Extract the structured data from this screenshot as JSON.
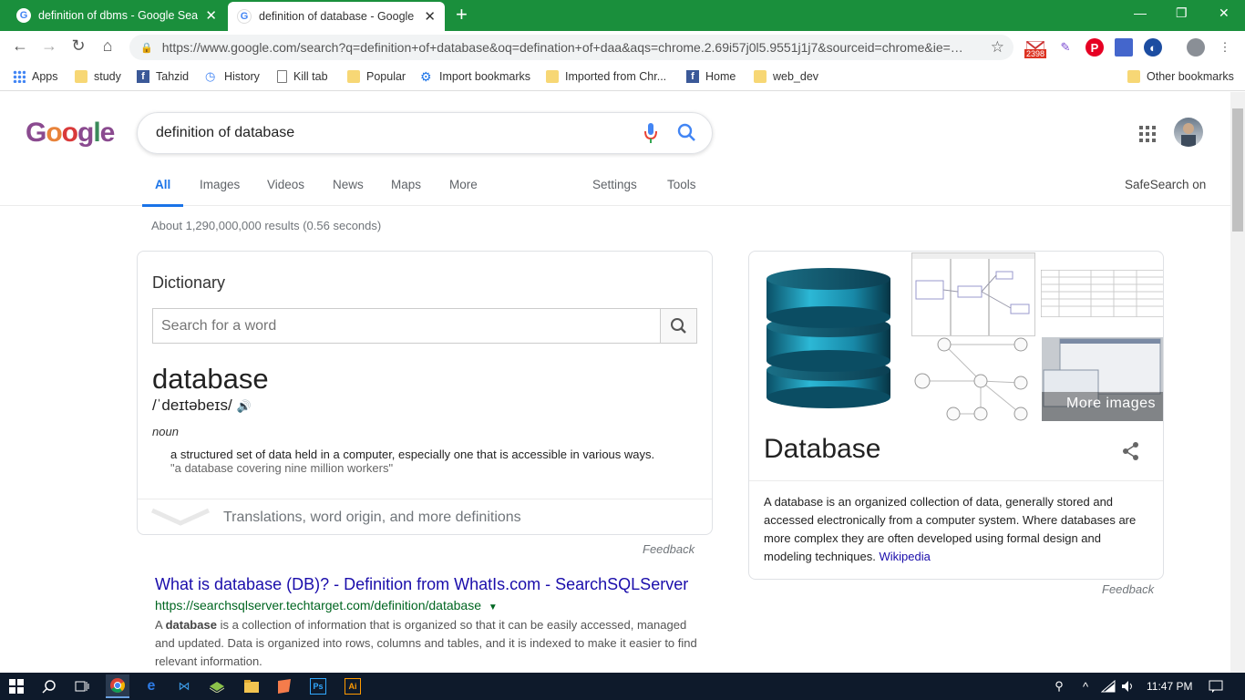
{
  "tabs": [
    {
      "title": "definition of dbms - Google Sear",
      "close": "✕"
    },
    {
      "title": "definition of database - Google S",
      "close": "✕"
    }
  ],
  "new_tab": "+",
  "window_controls": {
    "minimize": "—",
    "maximize": "❐",
    "close": "✕"
  },
  "address_bar": {
    "url": "https://www.google.com/search?q=definition+of+database&oq=defination+of+daa&aqs=chrome.2.69i57j0l5.9551j1j7&sourceid=chrome&ie=…"
  },
  "extensions": {
    "gmail_badge": "2398"
  },
  "bookmarks": [
    "Apps",
    "study",
    "Tahzid",
    "History",
    "Kill tab",
    "Popular",
    "Import bookmarks",
    "Imported from Chr...",
    "Home",
    "web_dev"
  ],
  "other_bookmarks": "Other bookmarks",
  "logo": "Google",
  "search": {
    "query": "definition of database"
  },
  "nav_tabs": [
    "All",
    "Images",
    "Videos",
    "News",
    "Maps",
    "More"
  ],
  "settings_label": "Settings",
  "tools_label": "Tools",
  "safesearch": "SafeSearch on",
  "results_stats": "About 1,290,000,000 results (0.56 seconds)",
  "dictionary": {
    "title": "Dictionary",
    "placeholder": "Search for a word",
    "word": "database",
    "pronunciation": "/ˈdeɪtəbeɪs/",
    "part_of_speech": "noun",
    "definition": "a structured set of data held in a computer, especially one that is accessible in various ways.",
    "example": "\"a database covering nine million workers\"",
    "more": "Translations, word origin, and more definitions"
  },
  "feedback": "Feedback",
  "result": {
    "title": "What is database (DB)? - Definition from WhatIs.com - SearchSQLServer",
    "url": "https://searchsqlserver.techtarget.com/definition/database",
    "snippet_bold": "database",
    "snippet_pre": "A ",
    "snippet_post": " is a collection of information that is organized so that it can be easily accessed, managed and updated. Data is organized into rows, columns and tables, and it is indexed to make it easier to find relevant information."
  },
  "knowledge_panel": {
    "title": "Database",
    "more_images": "More images",
    "description": "A database is an organized collection of data, generally stored and accessed electronically from a computer system. Where databases are more complex they are often developed using formal design and modeling techniques.",
    "source": "Wikipedia"
  },
  "taskbar": {
    "time": "11:47 PM"
  }
}
